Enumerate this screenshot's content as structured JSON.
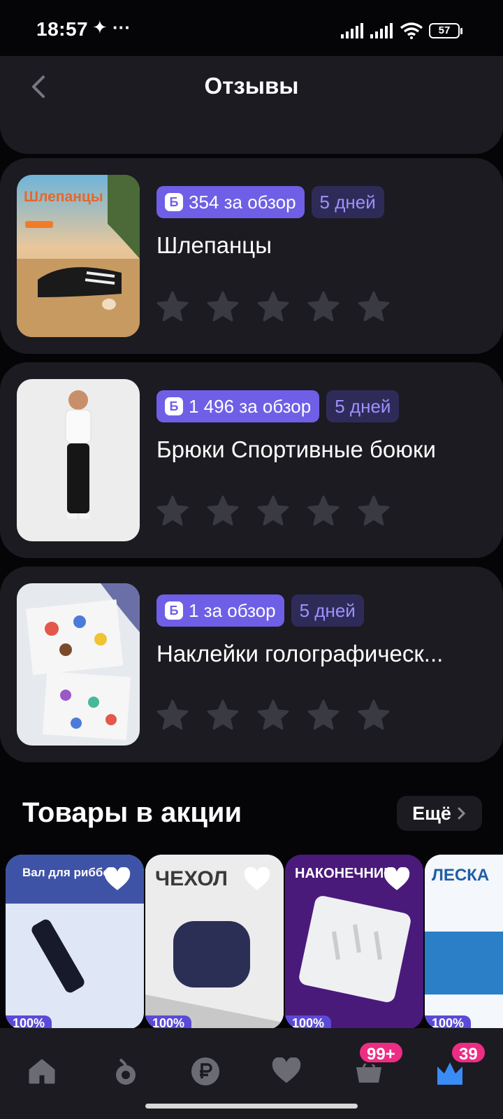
{
  "status_bar": {
    "time": "18:57",
    "extra": "✦ ···",
    "battery": "57"
  },
  "header": {
    "title": "Отзывы"
  },
  "reviews": [
    {
      "reward": "354 за обзор",
      "days": "5 дней",
      "title": "Шлепанцы",
      "rating": 0,
      "image_label": "Шлепанцы"
    },
    {
      "reward": "1 496 за обзор",
      "days": "5 дней",
      "title": "Брюки Спортивные боюки",
      "rating": 0,
      "image_label": ""
    },
    {
      "reward": "1 за обзор",
      "days": "5 дней",
      "title": "Наклейки голографическ...",
      "rating": 0,
      "image_label": ""
    }
  ],
  "reward_currency_icon": "Б",
  "promo": {
    "title": "Товары в акции",
    "more_label": "Ещё",
    "products": [
      {
        "caption": "Вал для риббона",
        "tag": "100%"
      },
      {
        "caption": "ЧЕХОЛ",
        "tag": "100%"
      },
      {
        "caption": "НАКОНЕЧНИКИ",
        "tag": "100%"
      },
      {
        "caption": "ЛЕСКА",
        "tag": "100%"
      }
    ]
  },
  "nav": {
    "cart_badge": "99+",
    "profile_badge": "39"
  },
  "colors": {
    "accent": "#6f5fe6",
    "badge": "#ec2d83",
    "card": "#1b1b21",
    "star": "#3a3a42"
  }
}
